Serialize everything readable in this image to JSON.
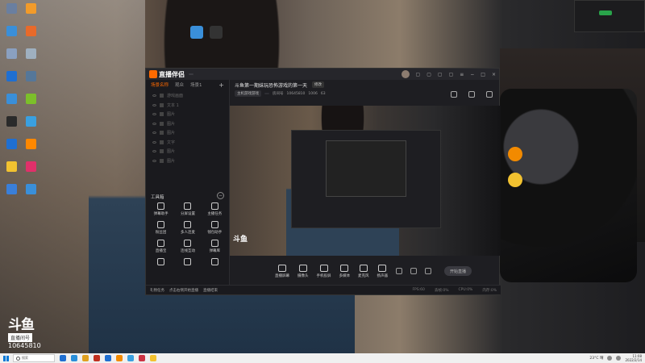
{
  "desktop": {
    "top_icons": [
      {
        "label": "",
        "color": "#3a8fd9"
      },
      {
        "label": "",
        "color": "#333333"
      }
    ],
    "left_icons": [
      {
        "label": "",
        "color": "#6a7fa0"
      },
      {
        "label": "",
        "color": "#f29b2a"
      },
      {
        "label": "",
        "color": "#3a8fd9"
      },
      {
        "label": "",
        "color": "#e86a2a"
      },
      {
        "label": "",
        "color": "#8aa0c0"
      },
      {
        "label": "",
        "color": "#9fb0c0"
      },
      {
        "label": "",
        "color": "#1f6fd1"
      },
      {
        "label": "",
        "color": "#557799"
      },
      {
        "label": "",
        "color": "#3a8fd9"
      },
      {
        "label": "",
        "color": "#7cbf2a"
      },
      {
        "label": "",
        "color": "#2a2a2a"
      },
      {
        "label": "",
        "color": "#3aa0e0"
      },
      {
        "label": "",
        "color": "#1f6fd1"
      },
      {
        "label": "",
        "color": "#ff8800"
      },
      {
        "label": "",
        "color": "#f2c230"
      },
      {
        "label": "",
        "color": "#e0306a"
      },
      {
        "label": "",
        "color": "#3a7fd9"
      },
      {
        "label": "",
        "color": "#3a8fd9"
      }
    ],
    "right_icons": [
      {
        "color": "#f28a00"
      },
      {
        "color": "#f2c230"
      }
    ],
    "douyu": {
      "mark": "斗鱼",
      "room_label": "直播间号",
      "room_number": "10645810"
    }
  },
  "notification": {
    "line1": "",
    "line2": "",
    "line3": ""
  },
  "app": {
    "logo": "直播伴侣",
    "version_badge": "",
    "tabs": [
      {
        "label": "场景名称"
      },
      {
        "label": "观众"
      },
      {
        "label": "场景1"
      }
    ],
    "add_label": "+",
    "scenes": [
      {
        "label": "游戏画面"
      },
      {
        "label": "文本 1"
      },
      {
        "label": "图片"
      },
      {
        "label": "图片"
      },
      {
        "label": "图片"
      },
      {
        "label": "文字"
      },
      {
        "label": "图片"
      },
      {
        "label": "图片"
      }
    ],
    "toolbox_title": "工具箱",
    "toolbox_toggle": "−",
    "tools": [
      {
        "label": "弹幕助手"
      },
      {
        "label": "分屏设置"
      },
      {
        "label": "主播任务"
      },
      {
        "label": "粉丝团"
      },
      {
        "label": "多人连麦"
      },
      {
        "label": "钱包助手"
      },
      {
        "label": "直播宝"
      },
      {
        "label": "连线互动"
      },
      {
        "label": "弹幕库"
      },
      {
        "label": ""
      },
      {
        "label": ""
      },
      {
        "label": ""
      }
    ],
    "stream_title": "斗鱼第一期妹玩恐怖游戏的第一天",
    "edit_btn": "修改",
    "meta_chip1": "主机游戏游戏",
    "meta_chip2": "",
    "meta_room_label": "房间号",
    "meta_room_number": "10645810",
    "meta_count": "1006",
    "meta_fans": "63",
    "preview_watermark": "斗鱼",
    "controls": [
      {
        "label": "直播屏幕"
      },
      {
        "label": "摄像头"
      },
      {
        "label": "手机投屏"
      },
      {
        "label": "多媒体"
      },
      {
        "label": "麦克风"
      },
      {
        "label": "扬声器"
      }
    ],
    "go_live": "开始直播",
    "status_left": "礼物任务",
    "status_mid": "点击右侧开始直播",
    "status_right": "直播结束",
    "stats": [
      "FPS:60",
      "丢帧:0%",
      "CPU:0%",
      "内存:0%"
    ]
  },
  "taskbar": {
    "search_placeholder": "搜索",
    "apps": [
      "#1f6fd1",
      "#2a8fd9",
      "#e0a020",
      "#c03020",
      "#1f6fd1",
      "#f28a00",
      "#3aa0e0",
      "#cc3344",
      "#f2c230"
    ],
    "weather": "23°C 晴",
    "time": "11:08",
    "date": "2022/2/14"
  }
}
